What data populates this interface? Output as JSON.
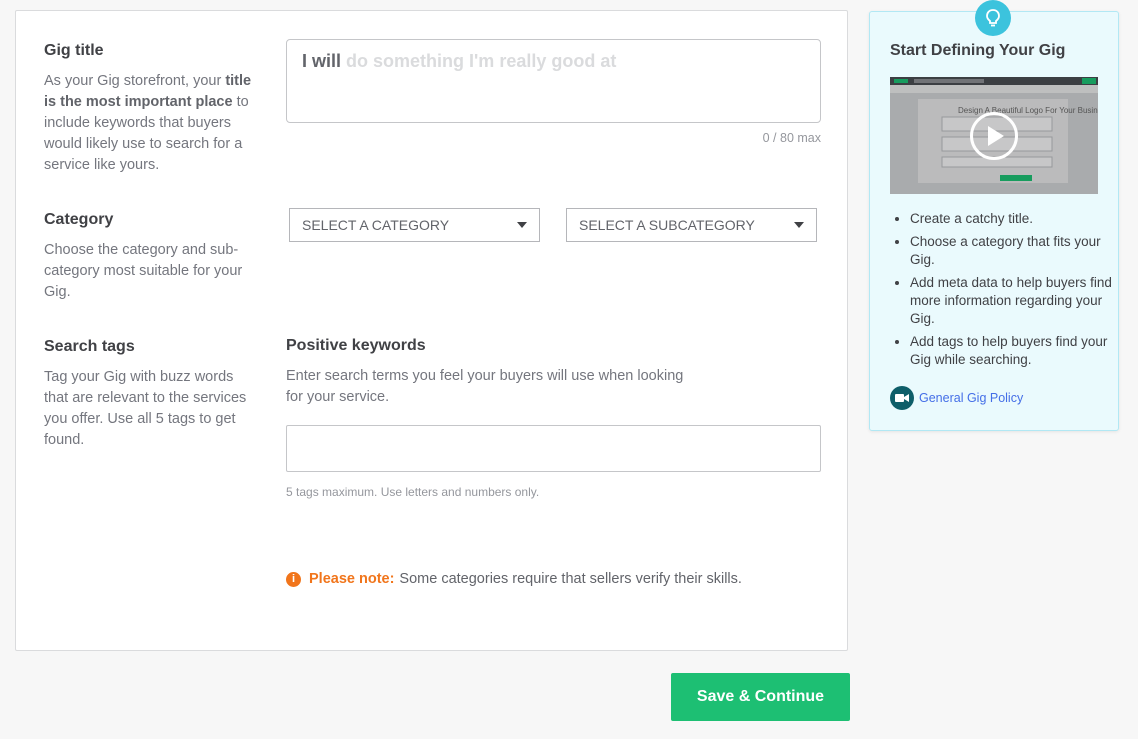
{
  "gig_title": {
    "label": "Gig title",
    "desc_1": "As your Gig storefront, your ",
    "desc_bold": "title is the most important place",
    "desc_2": " to include keywords that buyers would likely use to search for a service like yours.",
    "input_prefix": "I will",
    "input_placeholder": "do something I'm really good at",
    "char_count": "0 / 80 max"
  },
  "category": {
    "label": "Category",
    "desc": "Choose the category and sub-category most suitable for your Gig.",
    "category_select": "SELECT A CATEGORY",
    "subcategory_select": "SELECT A SUBCATEGORY"
  },
  "search_tags": {
    "label": "Search tags",
    "desc": "Tag your Gig with buzz words that are relevant to the services you offer. Use all 5 tags to get found.",
    "keywords_title": "Positive keywords",
    "keywords_desc": "Enter search terms you feel your buyers will use when looking for your service.",
    "hint": "5 tags maximum. Use letters and numbers only."
  },
  "note": {
    "label": "Please note:",
    "text": "Some categories require that sellers verify their skills."
  },
  "save_button": "Save & Continue",
  "tip_panel": {
    "title": "Start Defining Your Gig",
    "video_caption": "Design A Beautiful Logo For Your Business",
    "items": [
      "Create a catchy title.",
      "Choose a category that fits your Gig.",
      "Add meta data to help buyers find more information regarding your Gig.",
      "Add tags to help buyers find your Gig while searching."
    ],
    "policy_link": "General Gig Policy"
  },
  "colors": {
    "primary_green": "#1dbf73",
    "note_orange": "#f1751b",
    "tip_background": "#eafafd",
    "tip_accent": "#3cc3dd",
    "link_blue": "#446ee7"
  },
  "icons": [
    "lightbulb-icon",
    "play-icon",
    "info-icon",
    "video-camera-icon",
    "caret-down-icon"
  ]
}
